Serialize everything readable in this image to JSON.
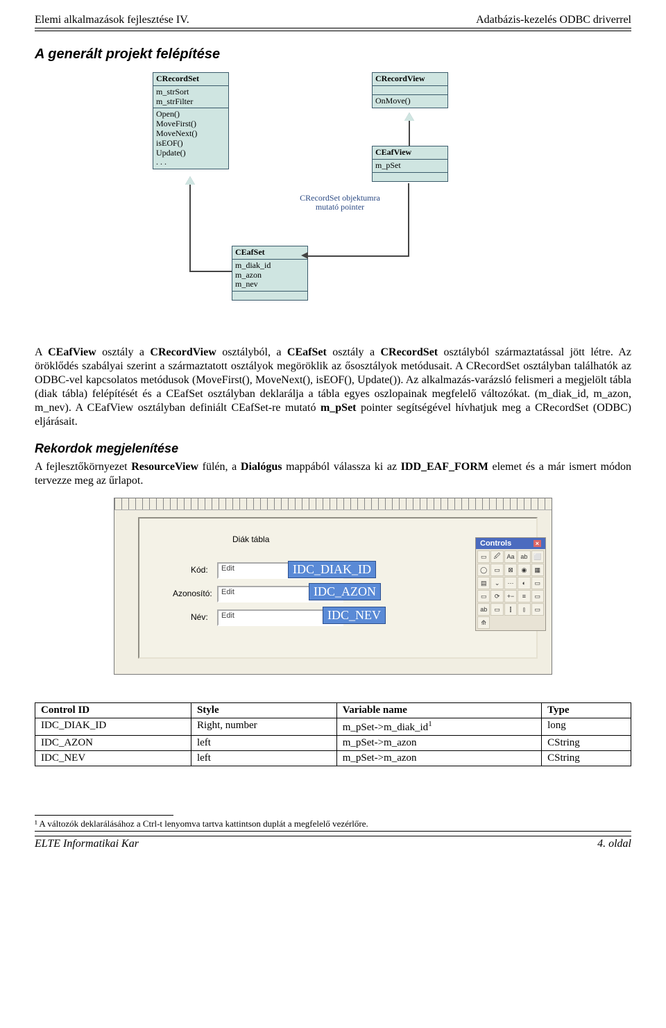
{
  "header": {
    "left": "Elemi alkalmazások fejlesztése IV.",
    "right": "Adatbázis-kezelés ODBC driverrel"
  },
  "title1": "A generált projekt felépítése",
  "uml": {
    "crecordset": {
      "head": "CRecordSet",
      "attrs": "m_strSort\nm_strFilter",
      "ops": "Open()\nMoveFirst()\nMoveNext()\nisEOF()\nUpdate()\n. . ."
    },
    "ceafset": {
      "head": "CEafSet",
      "attrs": "m_diak_id\nm_azon\nm_nev"
    },
    "crecordview": {
      "head": "CRecordView",
      "ops": "OnMove()"
    },
    "ceafview": {
      "head": "CEafView",
      "attrs": "m_pSet"
    },
    "note": "CRecordSet\nobjektumra mutató\npointer"
  },
  "para1_pre": "A ",
  "para1": "CEafView osztály a CRecordView osztályból, a CEafSet osztály a CRecordSet osztályból származtatással jött létre. Az öröklődés szabályai szerint a származtatott osztályok megöröklik az ősosztályok metódusait. A CRecordSet osztályban találhatók az ODBC-vel kapcsolatos metódusok (MoveFirst(), MoveNext(), isEOF(), Update()). Az alkalmazás-varázsló felismeri a megjelölt tábla (diak tábla) felépítését és a CEafSet osztályban deklarálja a tábla egyes oszlopainak megfelelő változókat. (m_diak_id, m_azon, m_nev). A CEafView osztályban definiált CEafSet-re mutató ",
  "para1_bold": "m_pSet",
  "para1_tail": " pointer segítségével hívhatjuk meg a CRecordSet (ODBC) eljárásait.",
  "title2": "Rekordok megjelenítése",
  "para2_a": "A fejlesztőkörnyezet ",
  "para2_b": "ResourceView",
  "para2_c": " fülén, a ",
  "para2_d": "Dialógus",
  "para2_e": " mappából válassza ki az ",
  "para2_f": "IDD_EAF_FORM",
  "para2_g": " elemet és a már ismert módon tervezze meg az űrlapot.",
  "form": {
    "group": "Diák tábla",
    "lbl_kod": "Kód:",
    "lbl_azon": "Azonosító:",
    "lbl_nev": "Név:",
    "editval": "Edit",
    "tag1": "IDC_DIAK_ID",
    "tag2": "IDC_AZON",
    "tag3": "IDC_NEV",
    "toolbox_title": "Controls",
    "tool_icons": [
      "▭",
      "🖉",
      "Aa",
      "ab",
      "⬜",
      "◯",
      "▭",
      "⊠",
      "◉",
      "▦",
      "▤",
      "⌄",
      "⋯",
      "◐",
      "▭",
      "▭",
      "⟳",
      "+−",
      "≡",
      "▭",
      "ab",
      "▭",
      "⫿",
      "⫾",
      "▭",
      "⟰"
    ]
  },
  "table": {
    "head": [
      "Control ID",
      "Style",
      "Variable name",
      "Type"
    ],
    "rows": [
      [
        "IDC_DIAK_ID",
        "Right, number",
        "m_pSet->m_diak_id",
        "long"
      ],
      [
        "IDC_AZON",
        "left",
        "m_pSet->m_azon",
        "CString"
      ],
      [
        "IDC_NEV",
        "left",
        "m_pSet->m_azon",
        "CString"
      ]
    ],
    "sup": "1"
  },
  "footnote": "¹ A változók deklarálásához a Ctrl-t lenyomva tartva kattintson duplát a megfelelő vezérlőre.",
  "footer": {
    "left": "ELTE Informatikai Kar",
    "right": "4. oldal"
  }
}
